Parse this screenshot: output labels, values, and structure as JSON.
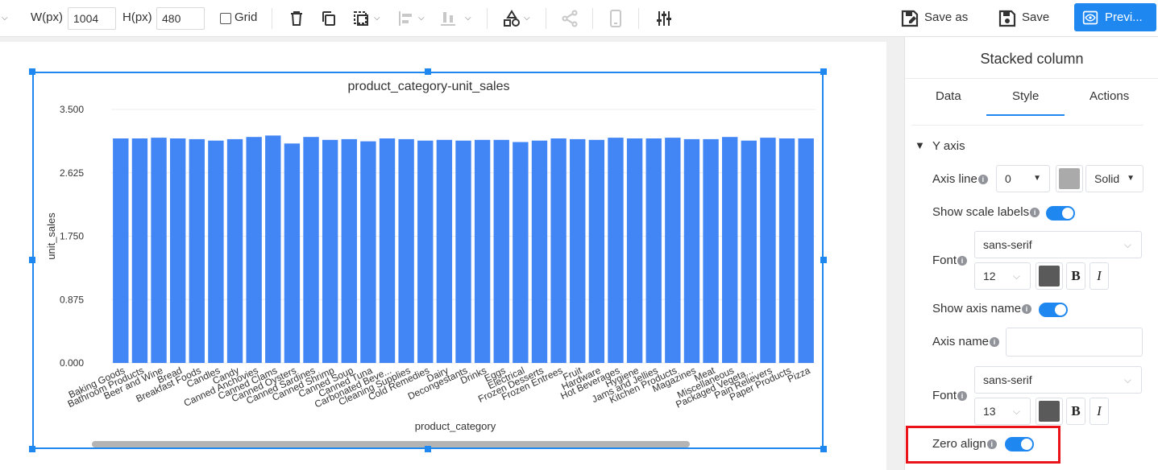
{
  "toolbar": {
    "width_label": "W(px)",
    "width_value": "1004",
    "height_label": "H(px)",
    "height_value": "480",
    "grid_label": "Grid",
    "save_as_label": "Save as",
    "save_label": "Save",
    "preview_label": "Previ...",
    "icons": [
      "delete-icon",
      "copy-icon",
      "select-icon",
      "align-horizontal-icon",
      "align-vertical-icon",
      "shapes-icon",
      "share-icon",
      "mobile-icon",
      "sliders-icon"
    ]
  },
  "chart": {
    "title": "product_category-unit_sales",
    "colors": {
      "bar": "#4285f4",
      "axis_text": "#333333",
      "grid": "#ececec"
    }
  },
  "chart_data": {
    "type": "bar",
    "title": "product_category-unit_sales",
    "xlabel": "product_category",
    "ylabel": "unit_sales",
    "ylim": [
      0,
      3500
    ],
    "yticks": [
      "0.000",
      "0.875",
      "1.750",
      "2.625",
      "3.500"
    ],
    "grid": true,
    "categories": [
      "Baking Goods",
      "Bathroom Products",
      "Beer and Wine",
      "Bread",
      "Breakfast Foods",
      "Candles",
      "Candy",
      "Canned Anchovies",
      "Canned Clams",
      "Canned Oysters",
      "Canned Sardines",
      "Canned Shrimp",
      "Canned Soup",
      "Canned Tuna",
      "Carbonated Beve...",
      "Cleaning Supplies",
      "Cold Remedies",
      "Dairy",
      "Decongestants",
      "Drinks",
      "Eggs",
      "Electrical",
      "Frozen Desserts",
      "Frozen Entrees",
      "Fruit",
      "Hardware",
      "Hot Beverages",
      "Hygiene",
      "Jams and Jellies",
      "Kitchen Products",
      "Magazines",
      "Meat",
      "Miscellaneous",
      "Packaged Vegeta...",
      "Pain Relievers",
      "Paper Products",
      "Pizza"
    ],
    "values": [
      3100,
      3100,
      3110,
      3100,
      3090,
      3070,
      3090,
      3120,
      3140,
      3030,
      3120,
      3080,
      3090,
      3060,
      3100,
      3090,
      3070,
      3080,
      3070,
      3080,
      3080,
      3050,
      3070,
      3100,
      3090,
      3080,
      3110,
      3100,
      3100,
      3110,
      3090,
      3090,
      3120,
      3070,
      3110,
      3100,
      3100
    ]
  },
  "panel": {
    "title": "Stacked column",
    "tabs": [
      "Data",
      "Style",
      "Actions"
    ],
    "active_tab": "Style",
    "section": "Y axis",
    "axis_line_label": "Axis line",
    "axis_line_width": "0",
    "axis_line_color": "#aaaaaa",
    "axis_line_style": "Solid",
    "show_scale_labels_label": "Show scale labels",
    "show_scale_labels": true,
    "font_label": "Font",
    "scale_font_family": "sans-serif",
    "scale_font_size": "12",
    "scale_font_color": "#5a5a5a",
    "bold_label": "B",
    "italic_label": "I",
    "show_axis_name_label": "Show axis name",
    "show_axis_name": true,
    "axis_name_label": "Axis name",
    "axis_name_value": "",
    "name_font_label": "Font",
    "name_font_family": "sans-serif",
    "name_font_size": "13",
    "name_font_color": "#5a5a5a",
    "zero_align_label": "Zero align",
    "zero_align": true,
    "info_glyph": "i"
  }
}
